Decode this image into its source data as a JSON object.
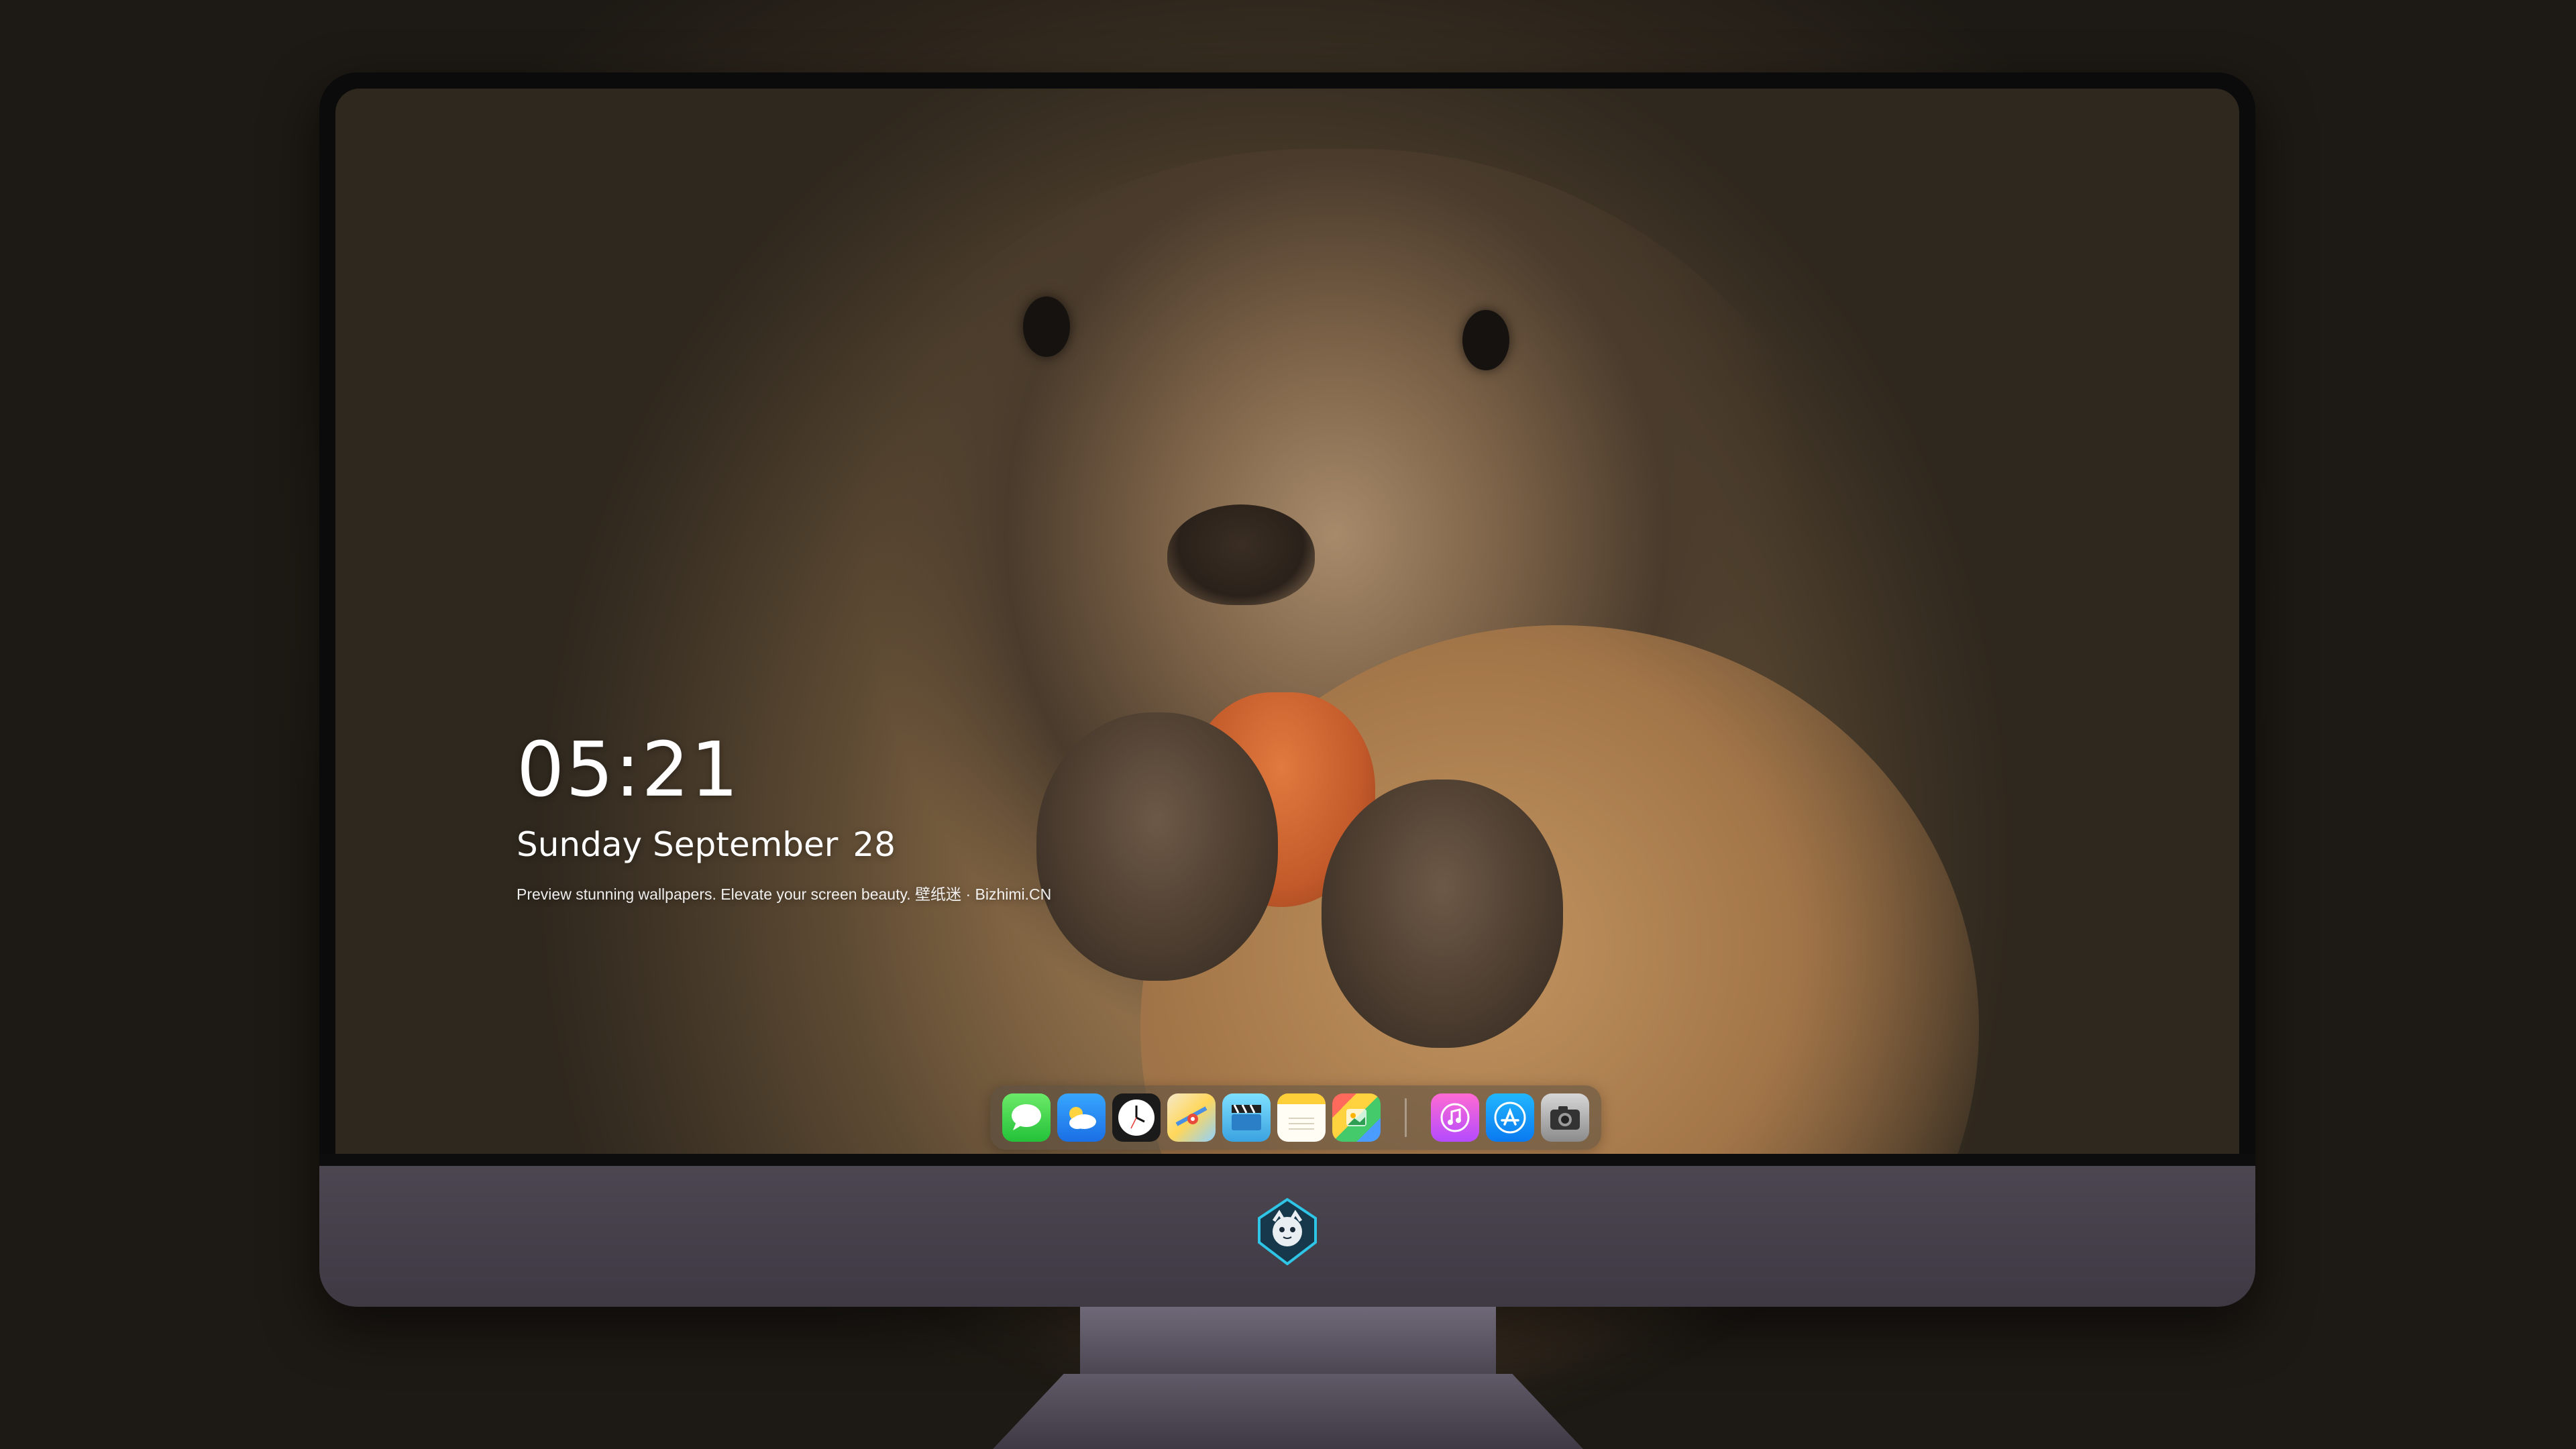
{
  "lock_screen": {
    "time": "05:21",
    "weekday": "Sunday",
    "month": "September",
    "day": "28",
    "tagline": "Preview stunning wallpapers. Elevate your screen beauty. 壁纸迷 · Bizhimi.CN"
  },
  "dock": {
    "apps": [
      {
        "name": "Messages",
        "icon": "messages-icon"
      },
      {
        "name": "Weather",
        "icon": "weather-icon"
      },
      {
        "name": "Clock",
        "icon": "clock-icon"
      },
      {
        "name": "Maps",
        "icon": "maps-icon"
      },
      {
        "name": "Clips",
        "icon": "video-icon"
      },
      {
        "name": "Notes",
        "icon": "notes-icon"
      },
      {
        "name": "Photos",
        "icon": "photos-icon"
      },
      {
        "name": "Music",
        "icon": "music-icon"
      },
      {
        "name": "App Store",
        "icon": "appstore-icon"
      },
      {
        "name": "Camera",
        "icon": "camera-icon"
      }
    ]
  },
  "monitor": {
    "logo": "shield-mascot-logo"
  },
  "colors": {
    "dock_background": "#5a4e42",
    "chin": "#4c4651",
    "bezel": "#0b0b0c"
  }
}
